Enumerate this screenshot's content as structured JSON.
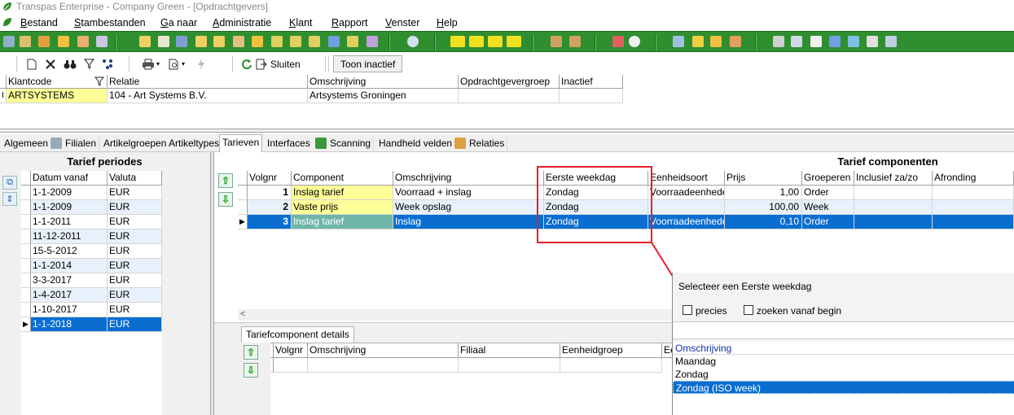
{
  "window": {
    "title": "Transpas Enterprise - Company Green - [Opdrachtgevers]"
  },
  "menu": [
    "Bestand",
    "Stambestanden",
    "Ga naar",
    "Administratie",
    "Klant",
    "Rapport",
    "Venster",
    "Help"
  ],
  "toolbar2": {
    "close_label": "Sluiten",
    "show_inactive_label": "Toon inactief"
  },
  "client_grid": {
    "headers": [
      "Klantcode",
      "Relatie",
      "Omschrijving",
      "Opdrachtgevergroep",
      "Inactief"
    ],
    "row": [
      "ARTSYSTEMS",
      "104 - Art Systems B.V.",
      "Artsystems Groningen",
      "",
      ""
    ]
  },
  "tabs": [
    "Algemeen",
    "Filialen",
    "Artikelgroepen",
    "Artikeltypes",
    "Tarieven",
    "Interfaces",
    "Scanning",
    "Handheld velden",
    "Relaties"
  ],
  "active_tab": "Tarieven",
  "tarief_periodes": {
    "title": "Tarief periodes",
    "headers": [
      "Datum vanaf",
      "Valuta"
    ],
    "rows": [
      [
        "1-1-2009",
        "EUR"
      ],
      [
        "1-1-2009",
        "EUR"
      ],
      [
        "1-1-2011",
        "EUR"
      ],
      [
        "11-12-2011",
        "EUR"
      ],
      [
        "15-5-2012",
        "EUR"
      ],
      [
        "1-1-2014",
        "EUR"
      ],
      [
        "3-3-2017",
        "EUR"
      ],
      [
        "1-4-2017",
        "EUR"
      ],
      [
        "1-10-2017",
        "EUR"
      ],
      [
        "1-1-2018",
        "EUR"
      ]
    ],
    "selected_index": 9
  },
  "tarief_componenten": {
    "title": "Tarief componenten",
    "headers": [
      "Volgnr",
      "Component",
      "Omschrijving",
      "Eerste weekdag",
      "Eenheidsoort",
      "Prijs",
      "Groeperen op",
      "Inclusief za/zo",
      "Afronding"
    ],
    "rows": [
      [
        "1",
        "Inslag tarief",
        "Voorraad + inslag",
        "Zondag",
        "Voorraadeenheden",
        "1,00",
        "Order",
        "",
        ""
      ],
      [
        "2",
        "Vaste prijs",
        "Week opslag",
        "Zondag",
        "",
        "100,00",
        "Week",
        "",
        ""
      ],
      [
        "3",
        "Inslag tarief",
        "Inslag",
        "Zondag",
        "Voorraadeenheden",
        "0,10",
        "Order",
        "",
        ""
      ]
    ],
    "selected_index": 2
  },
  "detail": {
    "tab_label": "Tariefcomponent details",
    "headers": [
      "Volgnr",
      "Omschrijving",
      "Filiaal",
      "Eenheidgroep",
      "Ee"
    ]
  },
  "popup": {
    "title": "Selecteer een Eerste weekdag",
    "opt_precies": "precies",
    "opt_zoeken": "zoeken vanaf begin",
    "list_header": "Omschrijving",
    "items": [
      "Maandag",
      "Zondag",
      "Zondag (ISO week)"
    ],
    "selected_index": 2
  },
  "colors": {
    "toolbar_green": "#2f8f2f",
    "selection_blue": "#0a6ed1",
    "highlight_yellow": "#ffff99",
    "annotation_red": "#e0202a"
  }
}
